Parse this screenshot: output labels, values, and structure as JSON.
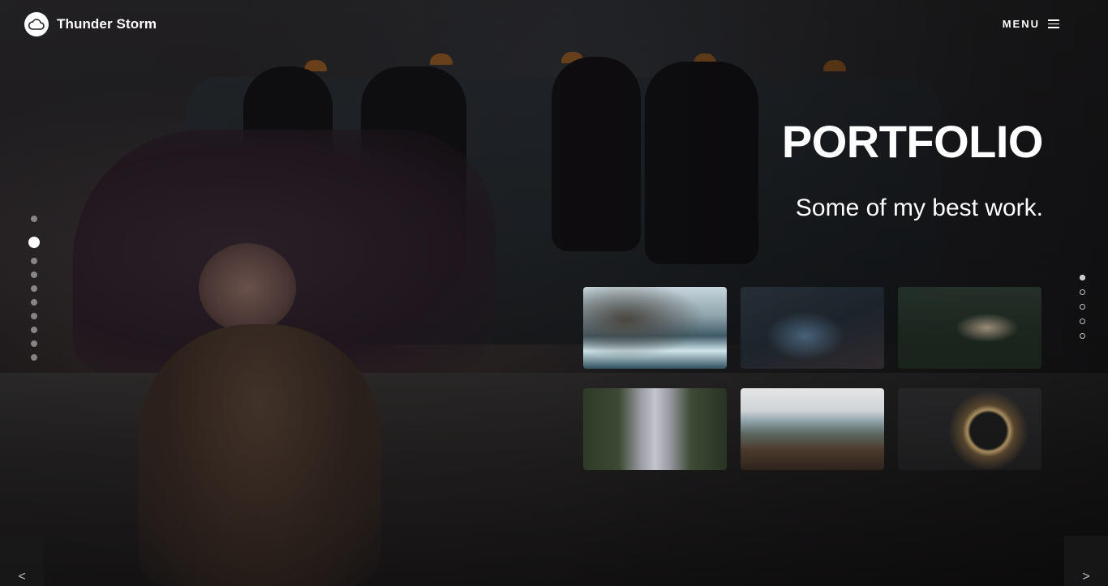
{
  "brand": {
    "name": "Thunder Storm",
    "logo_icon": "cloud-icon"
  },
  "nav": {
    "menu_label": "MENU",
    "menu_icon": "hamburger-icon"
  },
  "hero": {
    "title": "PORTFOLIO",
    "subtitle": "Some of my best work."
  },
  "gallery": {
    "items": [
      {
        "subject": "rocky-coast-waves",
        "highlighted": true
      },
      {
        "subject": "chain-link-fence-road-lights",
        "highlighted": false
      },
      {
        "subject": "woman-with-sparkler",
        "highlighted": false
      },
      {
        "subject": "city-bridge-street",
        "highlighted": true
      },
      {
        "subject": "beach-cliffs-shoreline",
        "highlighted": true
      },
      {
        "subject": "ring-of-fire-light-painting",
        "highlighted": false
      }
    ]
  },
  "section_nav": {
    "count": 5,
    "active_index": 0
  },
  "slide_rail": {
    "count": 11,
    "active_index": 2
  },
  "arrows": {
    "prev": "<",
    "next": ">"
  },
  "colors": {
    "accent": "#ffffff",
    "overlay": "#000000"
  }
}
